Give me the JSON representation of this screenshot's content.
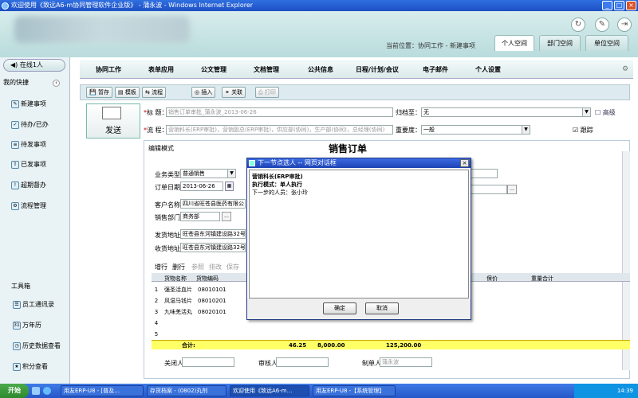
{
  "window": {
    "title": "欢迎使用《致远A6-m协同管理软件企业版》 - 蒲永波 - Windows Internet Explorer",
    "minimize": "_",
    "maximize": "□",
    "close": "×"
  },
  "header": {
    "location": "当前位置：协同工作 - 新建事项",
    "tabs": [
      "个人空间",
      "部门空间",
      "单位空间"
    ]
  },
  "left": {
    "online": "在线1人",
    "quick_title": "我的快捷",
    "quick_items": [
      "新建事项",
      "待办/已办",
      "待发事项",
      "已发事项",
      "超期督办",
      "流程管理"
    ],
    "tools_title": "工具箱",
    "tools": [
      "员工通讯录",
      "万年历",
      "历史数据查看",
      "积分查看"
    ]
  },
  "menu": [
    "协同工作",
    "表单应用",
    "公文管理",
    "文档管理",
    "公共信息",
    "日程/计划/会议",
    "电子邮件",
    "个人设置"
  ],
  "toolbar": {
    "save_draft": "暂存",
    "template": "模板",
    "flow": "流程",
    "insert": "插入",
    "relate": "关联",
    "print": "打印"
  },
  "compose": {
    "send": "发送",
    "title_label": "标 题：",
    "title_value": "销售订单审批_蒲永波_2013-06-26",
    "flow_label": "流 程：",
    "flow_value": "营销科长(ERP审批)，营销副总(ERP审批)，供应部(协同)，生产部(协同)，总经理(协同)",
    "archive_label": "归档至：",
    "archive_value": "无",
    "advanced": "高级",
    "importance_label": "重要度：",
    "importance_value": "一般",
    "track_label": "跟踪"
  },
  "form": {
    "mode": "编辑模式",
    "title": "销售订单",
    "biz_type_label": "业务类型",
    "biz_type_value": "普通销售",
    "order_date_label": "订单日期",
    "order_date_value": "2013-06-26",
    "customer_label": "客户名称",
    "customer_value": "四川省旺苍县医药有限公",
    "dept_label": "销售部门",
    "dept_value": "商务部",
    "ship_label": "发货地址",
    "ship_value": "旺苍县东河镇建设路32号",
    "receive_label": "收货地址",
    "receive_value": "旺苍县东河镇建设路32号",
    "grid_actions": [
      "增行",
      "删行",
      "参照",
      "排改",
      "保存"
    ],
    "columns": [
      "货物名称",
      "货物编码",
      "保价",
      "重量合计"
    ],
    "rows": [
      {
        "no": "1",
        "name": "强圣活血片",
        "code": "08010101"
      },
      {
        "no": "2",
        "name": "风湿马钱片",
        "code": "08010201"
      },
      {
        "no": "3",
        "name": "九味羌活丸",
        "code": "08020101"
      },
      {
        "no": "4",
        "name": "",
        "code": ""
      },
      {
        "no": "5",
        "name": "",
        "code": ""
      }
    ],
    "total_label": "合计:",
    "total_qty": "46.25",
    "total_a": "8,000.00",
    "total_b": "125,200.00",
    "closer_label": "关闭人",
    "auditor_label": "审核人",
    "creator_label": "制单人",
    "creator_value": "蒲永波"
  },
  "dialog": {
    "title": "下一节点选人 -- 网页对话框",
    "line1": "营销科长(ERP审批)",
    "line2": "执行模式：单人执行",
    "line3": "下一步的人员：张小玲",
    "ok": "确定",
    "cancel": "取消",
    "close": "×"
  },
  "taskbar": {
    "start": "开始",
    "tasks": [
      "用友ERP-U8 - [普及…",
      "存货档案 - (0802)丸剂",
      "欢迎使用《致远A6-m…",
      "用友ERP-U8 -【系统管理】"
    ],
    "time": "14:39"
  }
}
